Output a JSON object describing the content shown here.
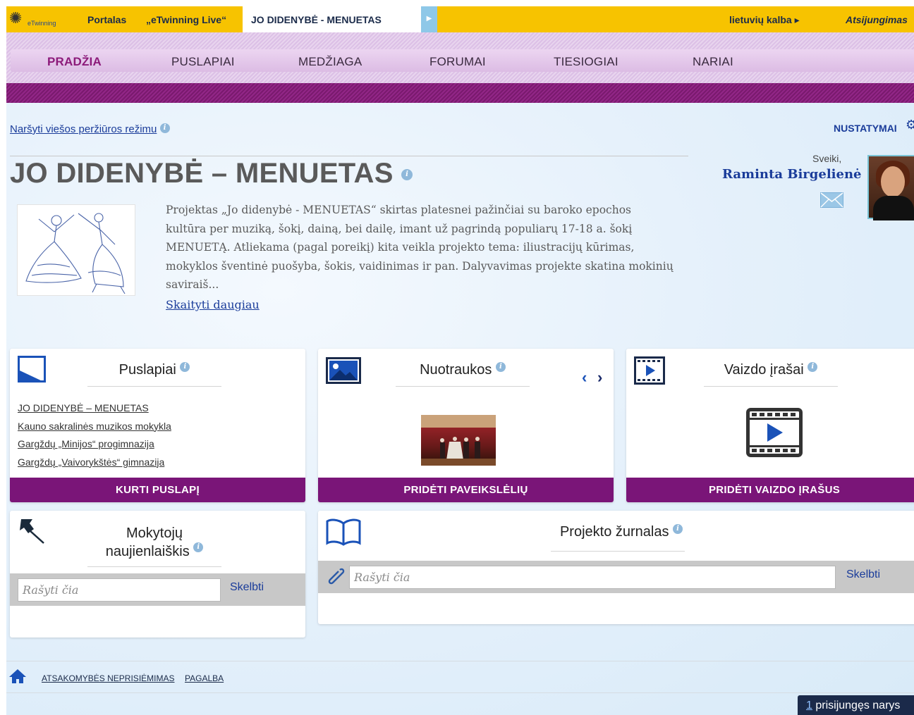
{
  "topbar": {
    "logo_text": "eTwinning",
    "portals": "Portalas",
    "live": "„eTwinning Live“",
    "project_tab": "JO DIDENYBĖ - MENUETAS",
    "language": "lietuvių kalba ▸",
    "logout": "Atsijungimas"
  },
  "nav": {
    "items": [
      "PRADŽIA",
      "PUSLAPIAI",
      "MEDŽIAGA",
      "FORUMAI",
      "TIESIOGIAI",
      "NARIAI"
    ]
  },
  "public_view": "Naršyti viešos peržiūros režimu",
  "settings": "NUSTATYMAI",
  "project": {
    "title": "JO DIDENYBĖ – MENUETAS",
    "description": "Projektas „Jo didenybė - MENUETAS“ skirtas platesnei pažinčiai su baroko epochos kultūra per muziką, šokį, dainą, bei dailę, imant už pagrindą populiarų 17-18 a. šokį MENUETĄ. Atliekama (pagal poreikį) kita veikla projekto tema: iliustracijų kūrimas, mokyklos šventinė puošyba, šokis, vaidinimas ir pan. Dalyvavimas projekte skatina mokinių saviraiš...",
    "read_more": "Skaityti daugiau"
  },
  "user": {
    "greeting": "Sveiki,",
    "name": "Raminta Birgelienė"
  },
  "cards": {
    "pages": {
      "title": "Puslapiai",
      "items": [
        "JO DIDENYBĖ – MENUETAS",
        "Kauno sakralinės muzikos mokykla",
        "Gargždų „Minijos“ progimnazija",
        "Gargždų „Vaivorykštės“ gimnazija"
      ],
      "button": "KURTI PUSLAPĮ"
    },
    "photos": {
      "title": "Nuotraukos",
      "button": "PRIDĖTI PAVEIKSLĖLIŲ"
    },
    "videos": {
      "title": "Vaizdo įrašai",
      "button": "PRIDĖTI VAIZDO ĮRAŠUS"
    },
    "newsletter": {
      "title_line1": "Mokytojų",
      "title_line2": "naujienlaiškis",
      "placeholder": "Rašyti čia",
      "post": "Skelbti"
    },
    "journal": {
      "title": "Projekto žurnalas",
      "placeholder": "Rašyti čia",
      "post": "Skelbti"
    }
  },
  "footer": {
    "disclaimer": "ATSAKOMYBĖS NEPRISIĖMIMAS",
    "help": "PAGALBA"
  },
  "online": {
    "count": "1",
    "label": " prisijungęs narys"
  },
  "colors": {
    "topbar": "#f7c300",
    "accent_purple": "#7a1578",
    "link_blue": "#1a3c9a"
  }
}
